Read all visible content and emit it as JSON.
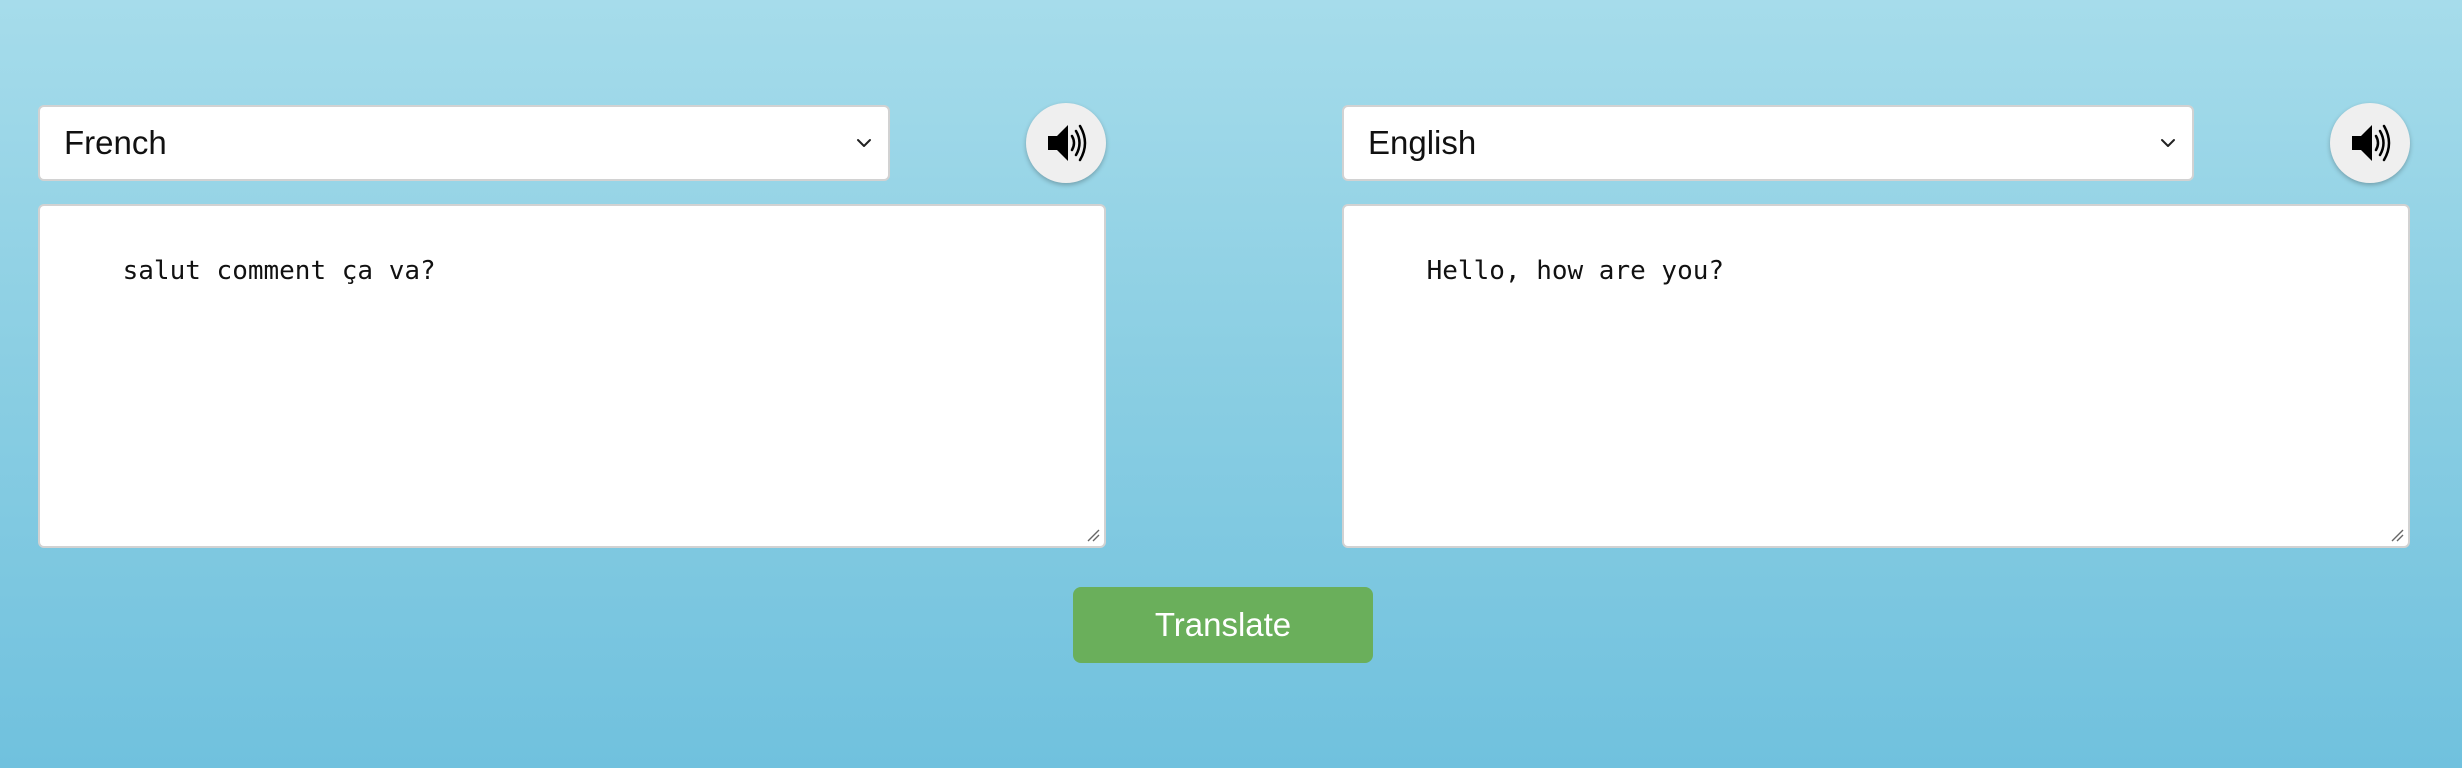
{
  "colors": {
    "background_top": "#a6dceb",
    "background_bottom": "#70c1de",
    "translate_button": "#6aaf5b",
    "field_background": "#ffffff",
    "speaker_button": "#efefef"
  },
  "source": {
    "language": "French",
    "text": "salut comment ça va?",
    "speaker_icon": "speaker-icon"
  },
  "target": {
    "language": "English",
    "text": "Hello, how are you?",
    "speaker_icon": "speaker-icon"
  },
  "actions": {
    "translate_label": "Translate"
  }
}
